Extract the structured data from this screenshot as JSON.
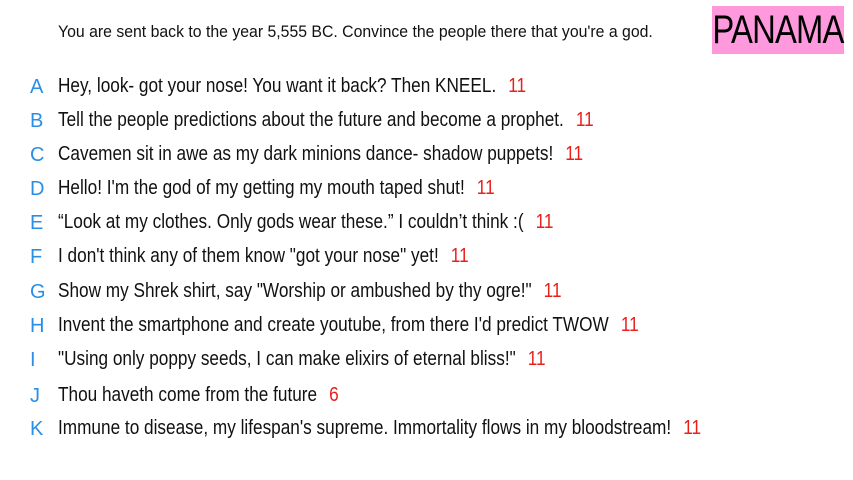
{
  "prompt": "You are sent back to the year 5,555 BC. Convince the people there that you're a god.",
  "brand": "PANAMA",
  "colors": {
    "letter": "#2a8ee6",
    "score": "#e8201c",
    "brand_bg": "#ff99dd",
    "text": "#111111"
  },
  "responses": [
    {
      "letter": "A",
      "text": "Hey, look- got your nose! You want it back? Then KNEEL.",
      "score": "11"
    },
    {
      "letter": "B",
      "text": "Tell the people predictions about the future and become a prophet.",
      "score": "11"
    },
    {
      "letter": "C",
      "text": "Cavemen sit in awe as my dark minions dance- shadow puppets!",
      "score": "11"
    },
    {
      "letter": "D",
      "text": "Hello! I'm the god of my getting my mouth taped shut!",
      "score": "11"
    },
    {
      "letter": "E",
      "text": "“Look at my clothes. Only gods wear these.” I couldn’t think :(",
      "score": "11"
    },
    {
      "letter": "F",
      "text": "I don't think any of them know \"got your nose\" yet!",
      "score": "11"
    },
    {
      "letter": "G",
      "text": "Show my Shrek shirt, say \"Worship or ambushed by thy ogre!\"",
      "score": "11"
    },
    {
      "letter": "H",
      "text": "Invent the smartphone and create youtube, from there I'd predict TWOW",
      "score": "11"
    },
    {
      "letter": "I",
      "text": "\"Using only poppy seeds, I can make elixirs of eternal bliss!\"",
      "score": "11"
    },
    {
      "letter": "J",
      "text": "Thou haveth come from the future",
      "score": "6"
    },
    {
      "letter": "K",
      "text": "Immune to disease, my lifespan's supreme. Immortality flows in my bloodstream!",
      "score": "11"
    }
  ]
}
